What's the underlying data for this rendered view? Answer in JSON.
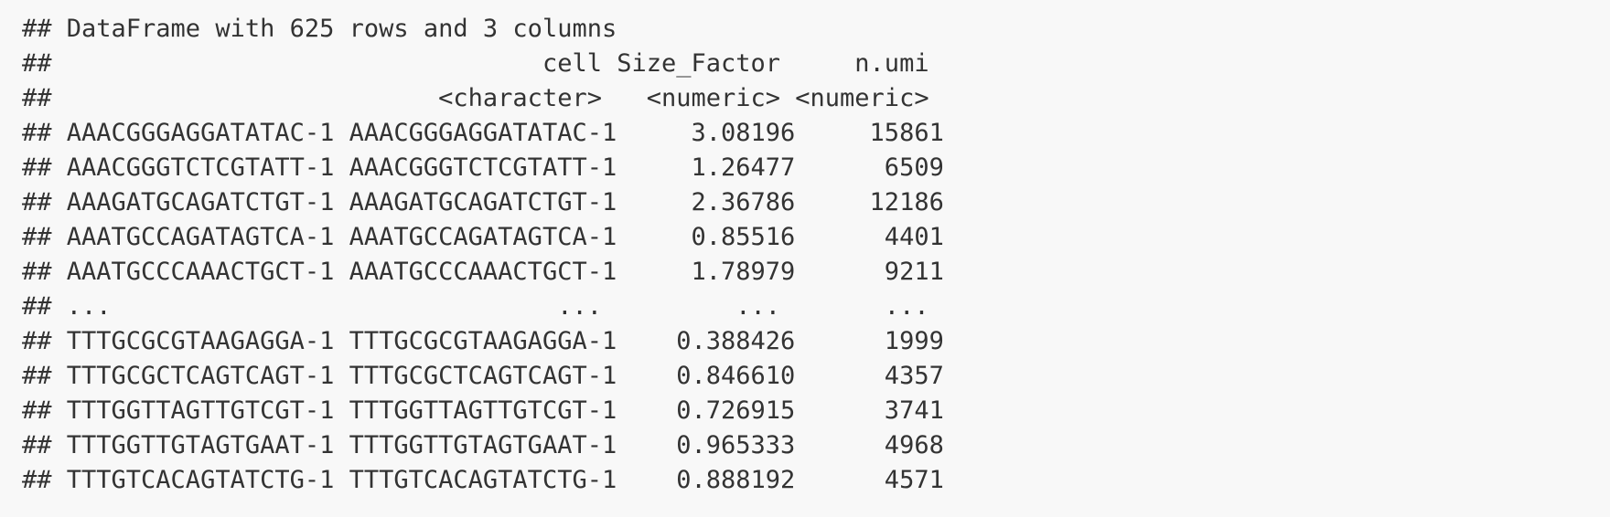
{
  "output": {
    "lines": [
      "## DataFrame with 625 rows and 3 columns",
      "##                                 cell Size_Factor     n.umi",
      "##                          <character>   <numeric> <numeric>",
      "## AAACGGGAGGATATAC-1 AAACGGGAGGATATAC-1     3.08196     15861",
      "## AAACGGGTCTCGTATT-1 AAACGGGTCTCGTATT-1     1.26477      6509",
      "## AAAGATGCAGATCTGT-1 AAAGATGCAGATCTGT-1     2.36786     12186",
      "## AAATGCCAGATAGTCA-1 AAATGCCAGATAGTCA-1     0.85516      4401",
      "## AAATGCCCAAACTGCT-1 AAATGCCCAAACTGCT-1     1.78979      9211",
      "## ...                              ...         ...       ...",
      "## TTTGCGCGTAAGAGGA-1 TTTGCGCGTAAGAGGA-1    0.388426      1999",
      "## TTTGCGCTCAGTCAGT-1 TTTGCGCTCAGTCAGT-1    0.846610      4357",
      "## TTTGGTTAGTTGTCGT-1 TTTGGTTAGTTGTCGT-1    0.726915      3741",
      "## TTTGGTTGTAGTGAAT-1 TTTGGTTGTAGTGAAT-1    0.965333      4968",
      "## TTTGTCACAGTATCTG-1 TTTGTCACAGTATCTG-1    0.888192      4571"
    ]
  }
}
